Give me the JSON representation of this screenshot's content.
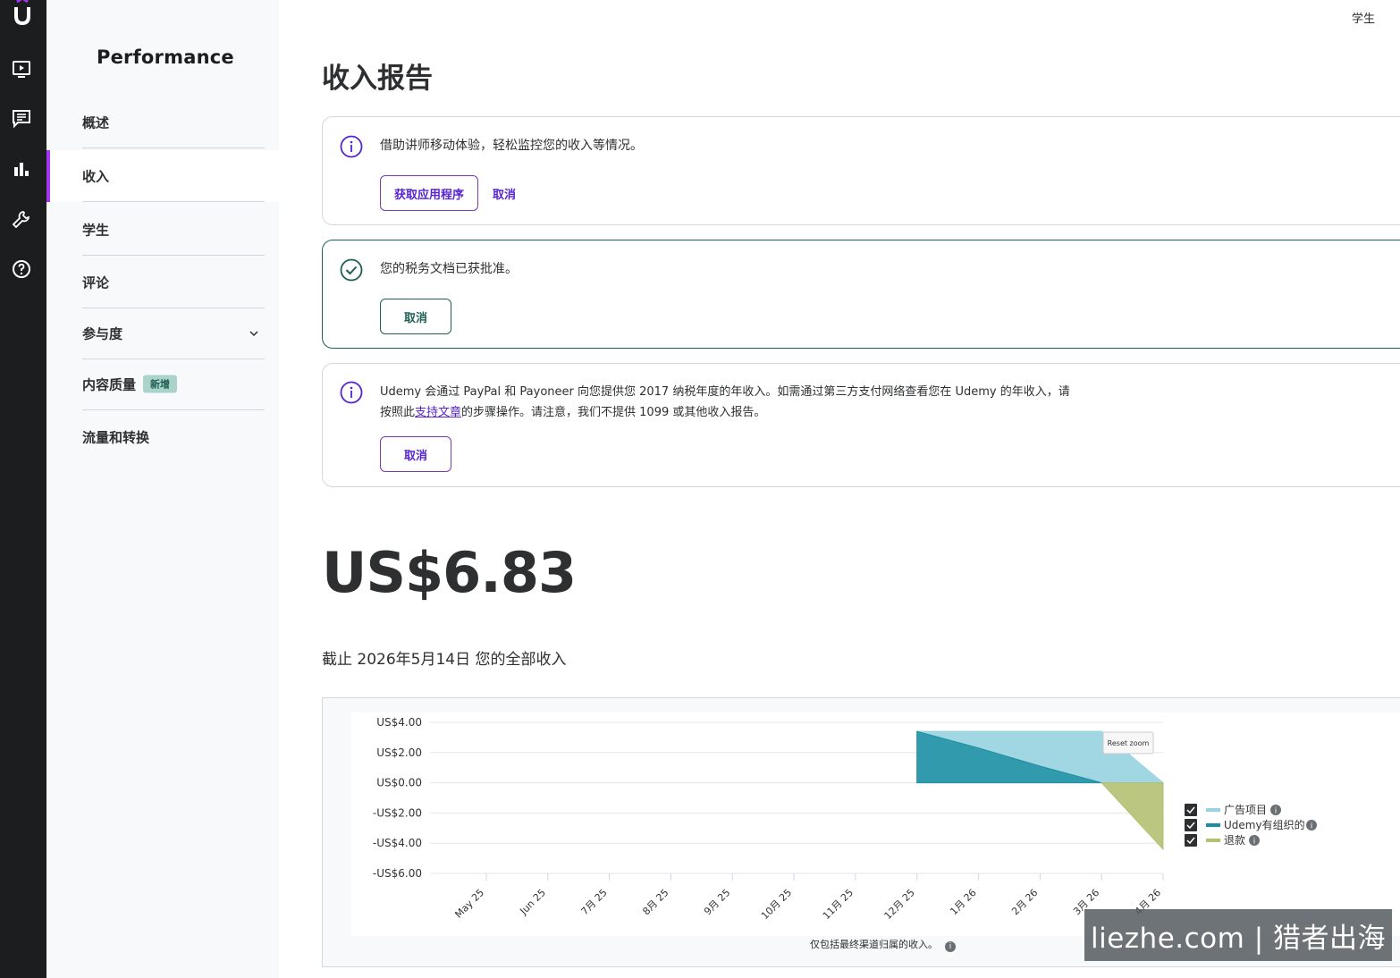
{
  "user_menu": {
    "label": "学生"
  },
  "sidebar": {
    "brand": "Performance",
    "items": [
      {
        "label": "概述"
      },
      {
        "label": "收入"
      },
      {
        "label": "学生"
      },
      {
        "label": "评论"
      },
      {
        "label": "参与度"
      },
      {
        "label": "内容质量",
        "badge": "新增"
      },
      {
        "label": "流量和转换"
      }
    ]
  },
  "page": {
    "title": "收入报告"
  },
  "alerts": {
    "mobile": {
      "message": "借助讲师移动体验，轻松监控您的收入等情况。",
      "primary": "获取应用程序",
      "dismiss": "取消"
    },
    "tax": {
      "message": "您的税务文档已获批准。",
      "dismiss": "取消"
    },
    "payout": {
      "line1": "Udemy 会通过 PayPal 和 Payoneer 向您提供您 2017 纳税年度的年收入。如需通过第三方支付网络查看您在 Udemy 的年收入，请",
      "line2_pre": "按照此",
      "line2_link": "支持文章",
      "line2_post": "的步骤操作。请注意，我们不提供 1099 或其他收入报告。",
      "dismiss": "取消"
    }
  },
  "summary": {
    "total": "US$6.83",
    "as_of": "截止 2026年5月14日 您的全部收入"
  },
  "chart_data": {
    "type": "area",
    "categories": [
      "May 25",
      "Jun 25",
      "7月 25",
      "8月 25",
      "9月 25",
      "10月 25",
      "11月 25",
      "12月 25",
      "1月 26",
      "2月 26",
      "3月 26",
      "4月 26"
    ],
    "y_ticks": [
      "US$4.00",
      "US$2.00",
      "US$0.00",
      "-US$2.00",
      "-US$4.00",
      "-US$6.00"
    ],
    "ylim": [
      -6,
      4
    ],
    "series": [
      {
        "name": "广告项目",
        "color": "#97d3e0",
        "values": [
          0,
          0,
          0,
          0,
          0,
          0,
          0,
          3.4,
          3.4,
          3.4,
          3.4,
          0
        ]
      },
      {
        "name": "Udemy有组织的",
        "color": "#1e8fa3",
        "values": [
          0,
          0,
          0,
          0,
          0,
          0,
          0,
          3.4,
          2.3,
          1.1,
          0,
          0
        ]
      },
      {
        "name": "退款",
        "color": "#b4c072",
        "values": [
          0,
          0,
          0,
          0,
          0,
          0,
          0,
          0,
          0,
          0,
          0,
          -4.4
        ]
      }
    ],
    "legend": "right",
    "grid": true,
    "reset_zoom_label": "Reset zoom",
    "footnote": "仅包括最终渠道归属的收入。"
  },
  "watermark": "liezhe.com | 猎者出海"
}
